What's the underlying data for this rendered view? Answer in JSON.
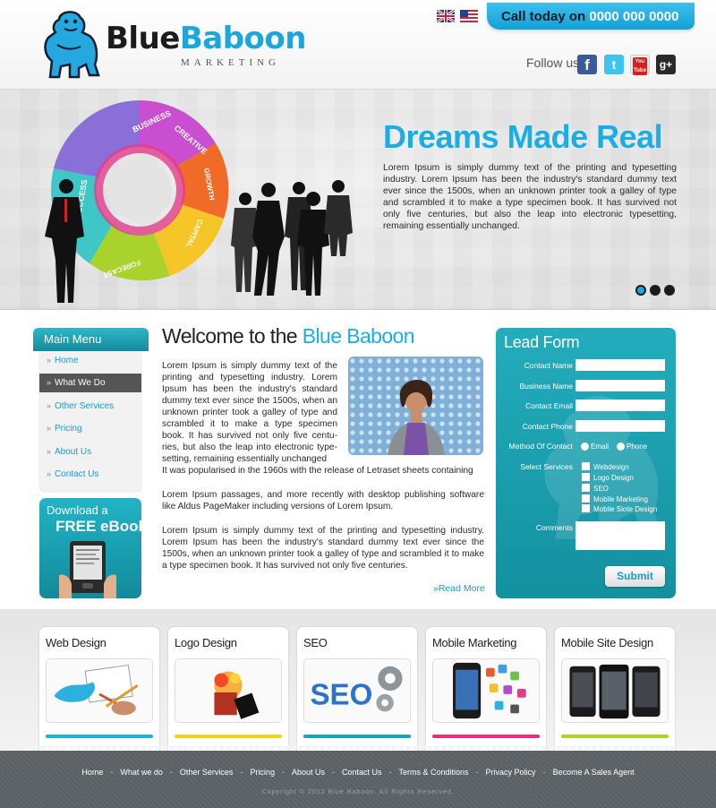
{
  "brand": {
    "name_part1": "Blue",
    "name_part2": "Baboon",
    "tagline": "MARKETING"
  },
  "header": {
    "call_label": "Call today on",
    "call_number": "0000 000 0000",
    "follow_label": "Follow us:",
    "social": [
      "f",
      "t",
      "You Tube",
      "g+"
    ]
  },
  "hero": {
    "title": "Dreams Made Real",
    "text": "Lorem Ipsum is simply dummy text of the printing and typesetting industry. Lorem Ipsum has been the industry's standard dummy text ever since the 1500s, when an unknown printer took a galley of type and scrambled it to make a type specimen book. It has survived not only five centuries, but also the leap into electronic typesetting, remaining essentially unchanged.",
    "ring_labels": [
      "BUSINESS",
      "CREATIVE",
      "GROWTH",
      "CAPITAL",
      "FORECAST",
      "SUCCESS"
    ],
    "slides": 3,
    "active_slide": 1
  },
  "menu": {
    "title": "Main Menu",
    "arrow": "»",
    "items": [
      {
        "label": "Home"
      },
      {
        "label": "What We Do"
      },
      {
        "label": "Other Services"
      },
      {
        "label": "Pricing"
      },
      {
        "label": "About Us"
      },
      {
        "label": "Contact Us"
      }
    ],
    "active_index": 1
  },
  "ebook": {
    "line1": "Download a",
    "line2": "FREE eBook"
  },
  "welcome": {
    "title_plain": "Welcome to the",
    "title_highlight": "Blue Baboon",
    "p1": "Lorem Ipsum is simply dummy text of the printing and typesetting industry. Lorem Ipsum has been the industry's standard dummy text ever since the 1500s, when an unknown printer took a galley of type and scrambled it to make a type specimen book. It has survived not only five centu-ries, but also the leap into electronic type-setting, remaining essentially unchanged",
    "p1b": "It was popularised in the 1960s with the release of Letraset sheets containing",
    "p2": "Lorem Ipsum passages, and more recently with desktop publishing software like Aldus PageMaker including versions of Lorem Ipsum.",
    "p3": "Lorem Ipsum is simply dummy text of the printing and typesetting industry. Lorem Ipsum has been the industry's standard dummy text ever since the 1500s, when an unknown printer took a galley of type and scrambled it to make a type specimen book. It has survived not only five centuries.",
    "read_more": "»Read More"
  },
  "lead_form": {
    "title": "Lead Form",
    "fields": [
      "Contact Name",
      "Business Name",
      "Contact Email",
      "Contact Phone"
    ],
    "method_label": "Method Of Contact",
    "methods": [
      "Email",
      "Phone"
    ],
    "services_label": "Select Services",
    "services": [
      "Webdesign",
      "Logo Design",
      "SEO",
      "Mobile Marketing",
      "Mobile Siote Design"
    ],
    "comments_label": "Comments",
    "submit": "Submit"
  },
  "services": [
    {
      "title": "Web Design",
      "accent": "#1fb4dd"
    },
    {
      "title": "Logo Design",
      "accent": "#f0d21e"
    },
    {
      "title": "SEO",
      "accent": "#1aa6b4"
    },
    {
      "title": "Mobile Marketing",
      "accent": "#ec2f7d"
    },
    {
      "title": "Mobile Site Design",
      "accent": "#a9d52b"
    }
  ],
  "footer": {
    "links": [
      "Home",
      "What we do",
      "Other Services",
      "Pricing",
      "About Us",
      "Contact Us",
      "Terms & Conditions",
      "Privacy Policy",
      "Become A Sales Agent"
    ],
    "separator": "-",
    "copyright": "Copyright © 2012 Blue Baboon. All Rights Reserved."
  },
  "colors": {
    "accent": "#1aaee4",
    "teal": "#1a9fb0",
    "footer": "#5d6266"
  }
}
